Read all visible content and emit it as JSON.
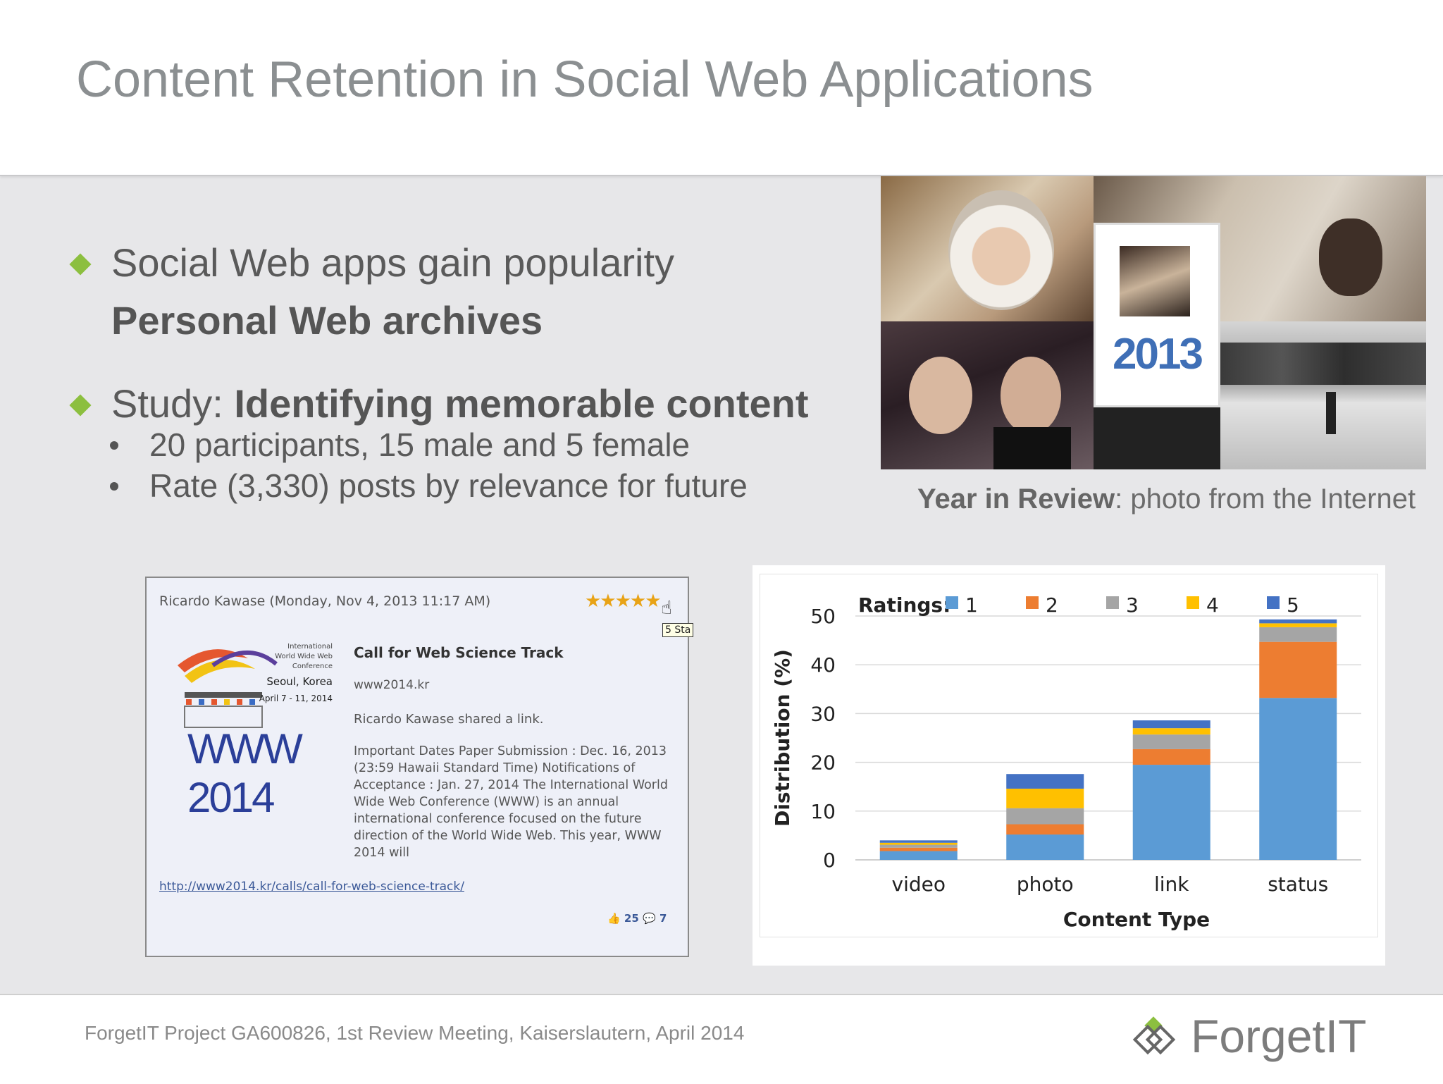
{
  "slide": {
    "title": "Content Retention in Social Web Applications"
  },
  "bullets": {
    "b1_text": "Social Web apps gain popularity",
    "b1_sub_bold": "Personal Web archives",
    "b2_prefix": "Study: ",
    "b2_bold": "Identifying memorable content",
    "sub_items": [
      "20 participants, 15 male and 5 female",
      "Rate (3,330) posts by relevance for future"
    ]
  },
  "photo": {
    "year_label": "2013",
    "caption_bold": "Year in Review",
    "caption_rest": ": photo from the Internet"
  },
  "post": {
    "header": "Ricardo Kawase (Monday, Nov 4, 2013 11:17 AM)",
    "stars": "★★★★★",
    "tooltip": "5 Sta",
    "logo_small_lines": [
      "International",
      "World Wide Web",
      "Conference"
    ],
    "logo_city": "Seoul, Korea",
    "logo_dates": "April 7 - 11, 2014",
    "logo_main": "WWW 2014",
    "title": "Call for Web Science Track",
    "domain": "www2014.kr",
    "shared": "Ricardo Kawase shared a link.",
    "body": "Important Dates Paper Submission : Dec. 16, 2013 (23:59 Hawaii Standard Time) Notifications of Acceptance : Jan. 27, 2014 The International World Wide Web Conference (WWW) is an annual international conference focused on the future direction of the World Wide Web. This year, WWW 2014 will",
    "link": "http://www2014.kr/calls/call-for-web-science-track/",
    "likes": "25",
    "comments": "7"
  },
  "chart_data": {
    "type": "bar",
    "stacked": true,
    "title": "",
    "legend_title": "Ratings:",
    "xlabel": "Content Type",
    "ylabel": "Distribution (%)",
    "ylim": [
      0,
      50
    ],
    "yticks": [
      0,
      10,
      20,
      30,
      40,
      50
    ],
    "grid": true,
    "legend_position": "top",
    "categories": [
      "video",
      "photo",
      "link",
      "status"
    ],
    "series": [
      {
        "name": "1",
        "color": "#5b9bd5",
        "values": [
          1.8,
          5.2,
          19.5,
          33.2
        ]
      },
      {
        "name": "2",
        "color": "#ed7d31",
        "values": [
          0.7,
          2.1,
          3.2,
          11.5
        ]
      },
      {
        "name": "3",
        "color": "#a5a5a5",
        "values": [
          0.6,
          3.3,
          3.0,
          3.0
        ]
      },
      {
        "name": "4",
        "color": "#ffc000",
        "values": [
          0.4,
          4.0,
          1.3,
          0.8
        ]
      },
      {
        "name": "5",
        "color": "#4472c4",
        "values": [
          0.5,
          3.0,
          1.6,
          0.8
        ]
      }
    ]
  },
  "footer": {
    "text": "ForgetIT Project GA600826, 1st Review Meeting, Kaiserslautern, April 2014",
    "logo": "ForgetIT"
  }
}
